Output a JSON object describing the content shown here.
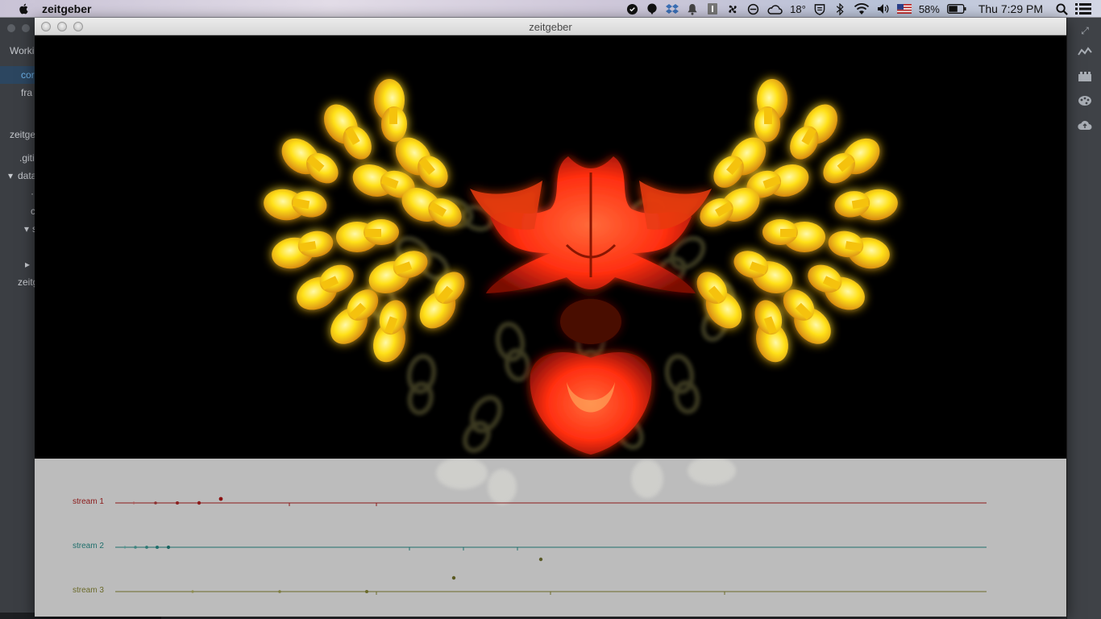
{
  "menubar": {
    "app_name": "zeitgeber",
    "temperature": "18°",
    "battery": "58%",
    "clock": "Thu 7:29 PM",
    "icons": [
      "apple-icon",
      "speech-bubble-icon",
      "balloon-icon",
      "dropbox-icon",
      "bell-icon",
      "info-icon",
      "fan-icon",
      "sync-icon",
      "weather-icon",
      "shield-icon",
      "bluetooth-icon",
      "wifi-icon",
      "volume-icon",
      "us-flag-icon",
      "battery-icon",
      "search-icon",
      "list-icon"
    ]
  },
  "editor": {
    "sidebar": {
      "working_files_header": "Worki",
      "files": [
        "cor",
        "fra"
      ],
      "project_header": "zeitge",
      "tree": [
        ".giti",
        "data",
        "·",
        "c",
        "",
        "s",
        "zeitg"
      ]
    }
  },
  "window": {
    "title": "zeitgeber"
  },
  "streams": [
    {
      "label": "stream 1",
      "color": "#8b1a1a"
    },
    {
      "label": "stream 2",
      "color": "#1f6f6c"
    },
    {
      "label": "stream 3",
      "color": "#6b6a2a"
    }
  ]
}
